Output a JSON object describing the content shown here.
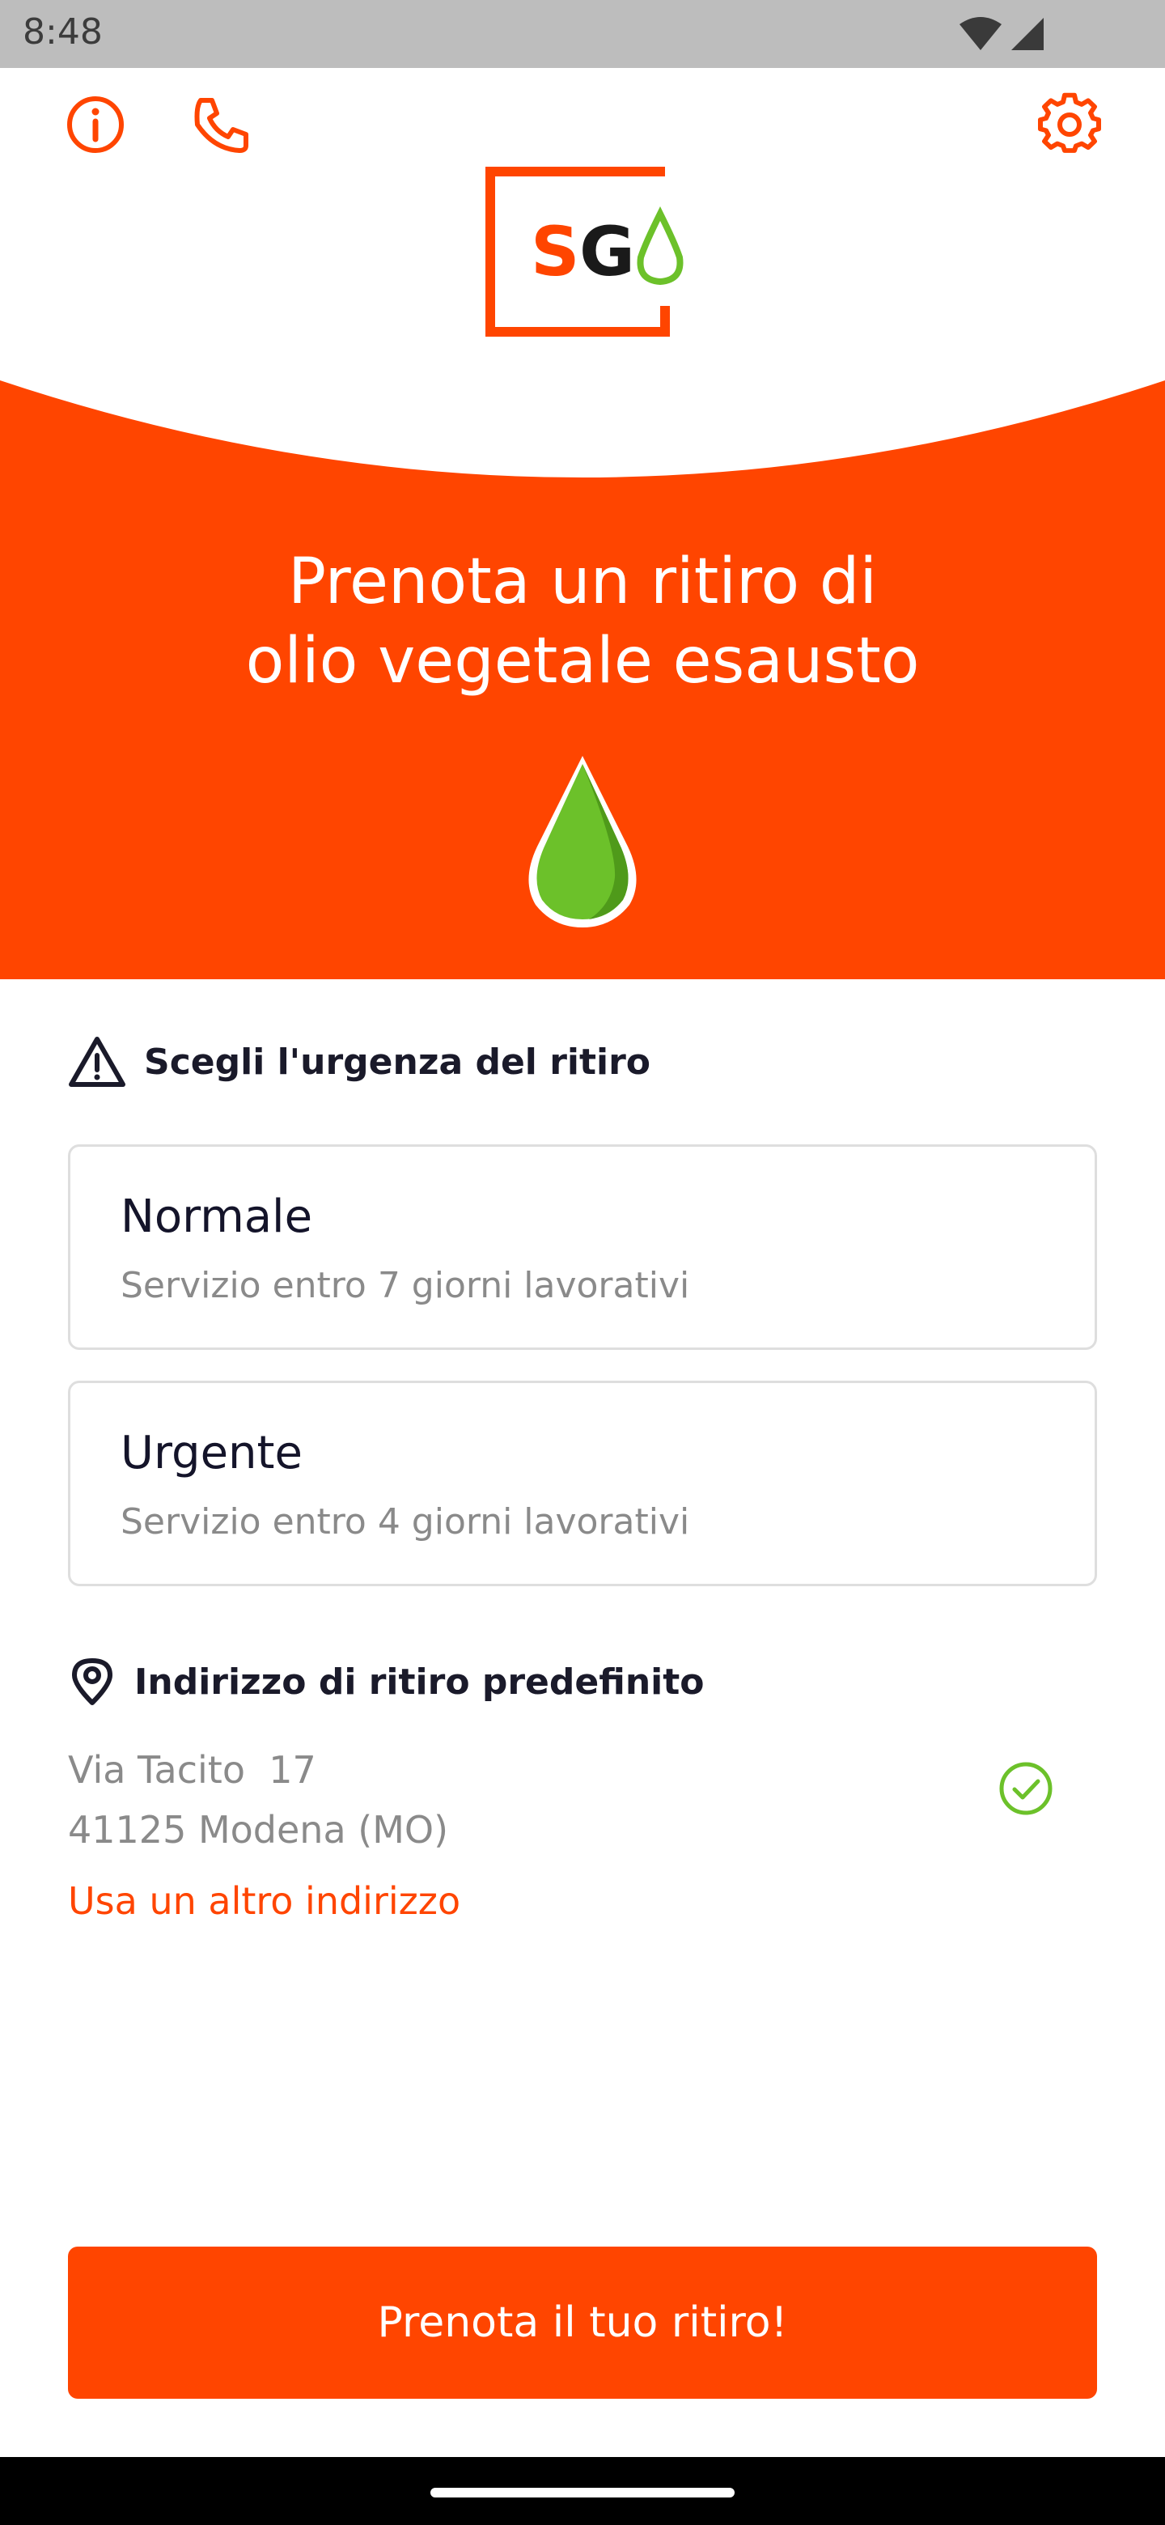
{
  "status_bar": {
    "time": "8:48",
    "icons": [
      "wifi-icon",
      "cell-signal-icon"
    ]
  },
  "header": {
    "info_icon": "info-icon",
    "phone_icon": "phone-icon",
    "settings_icon": "gear-icon",
    "logo_text": "SG"
  },
  "hero": {
    "title_line1": "Prenota un ritiro di",
    "title_line2": "olio vegetale esausto",
    "drop_icon": "oil-drop-icon"
  },
  "urgency": {
    "heading": "Scegli l'urgenza del ritiro",
    "options": [
      {
        "title": "Normale",
        "description": "Servizio entro 7 giorni lavorativi"
      },
      {
        "title": "Urgente",
        "description": "Servizio entro 4 giorni lavorativi"
      }
    ]
  },
  "address": {
    "heading": "Indirizzo di ritiro predefinito",
    "line1": "Via Tacito  17",
    "line2": "41125 Modena (MO)",
    "alt_link": "Usa un altro indirizzo"
  },
  "cta": {
    "label": "Prenota il tuo ritiro!"
  },
  "colors": {
    "brand_orange": "#ff4500",
    "leaf_green": "#6cc12a",
    "text_dark": "#14142a",
    "text_muted": "#8a8a8a"
  }
}
